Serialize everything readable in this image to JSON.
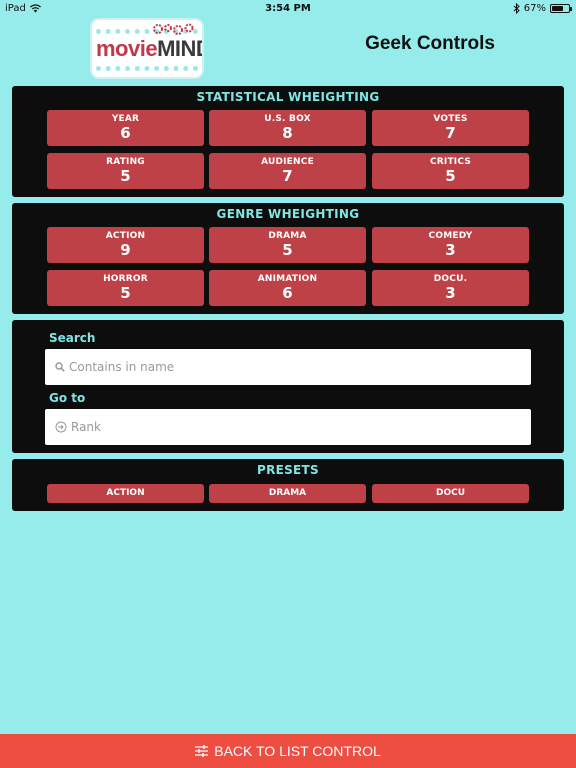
{
  "status_bar": {
    "device": "iPad",
    "time": "3:54 PM",
    "battery": "67%",
    "battery_level": 0.67
  },
  "header": {
    "logo_movie": "movie",
    "logo_mind": "MIND",
    "title": "Geek Controls"
  },
  "statistical": {
    "title": "STATISTICAL WHEIGHTING",
    "tiles": [
      {
        "label": "YEAR",
        "value": "6"
      },
      {
        "label": "U.S. BOX",
        "value": "8"
      },
      {
        "label": "VOTES",
        "value": "7"
      },
      {
        "label": "RATING",
        "value": "5"
      },
      {
        "label": "AUDIENCE",
        "value": "7"
      },
      {
        "label": "CRITICS",
        "value": "5"
      }
    ]
  },
  "genre": {
    "title": "GENRE WHEIGHTING",
    "tiles": [
      {
        "label": "ACTION",
        "value": "9"
      },
      {
        "label": "DRAMA",
        "value": "5"
      },
      {
        "label": "COMEDY",
        "value": "3"
      },
      {
        "label": "HORROR",
        "value": "5"
      },
      {
        "label": "ANIMATION",
        "value": "6"
      },
      {
        "label": "DOCU.",
        "value": "3"
      }
    ]
  },
  "search": {
    "label": "Search",
    "placeholder": "Contains in name",
    "value": ""
  },
  "goto": {
    "label": "Go to",
    "placeholder": "Rank",
    "value": ""
  },
  "presets": {
    "title": "PRESETS",
    "items": [
      "ACTION",
      "DRAMA",
      "DOCU"
    ]
  },
  "bottom_bar": {
    "label": "BACK TO LIST CONTROL"
  },
  "colors": {
    "background": "#96ecea",
    "panel": "#0d0d0d",
    "tile": "#bd4147",
    "panel_title": "#7fe6e3",
    "bottom_bar": "#ee4d42"
  }
}
